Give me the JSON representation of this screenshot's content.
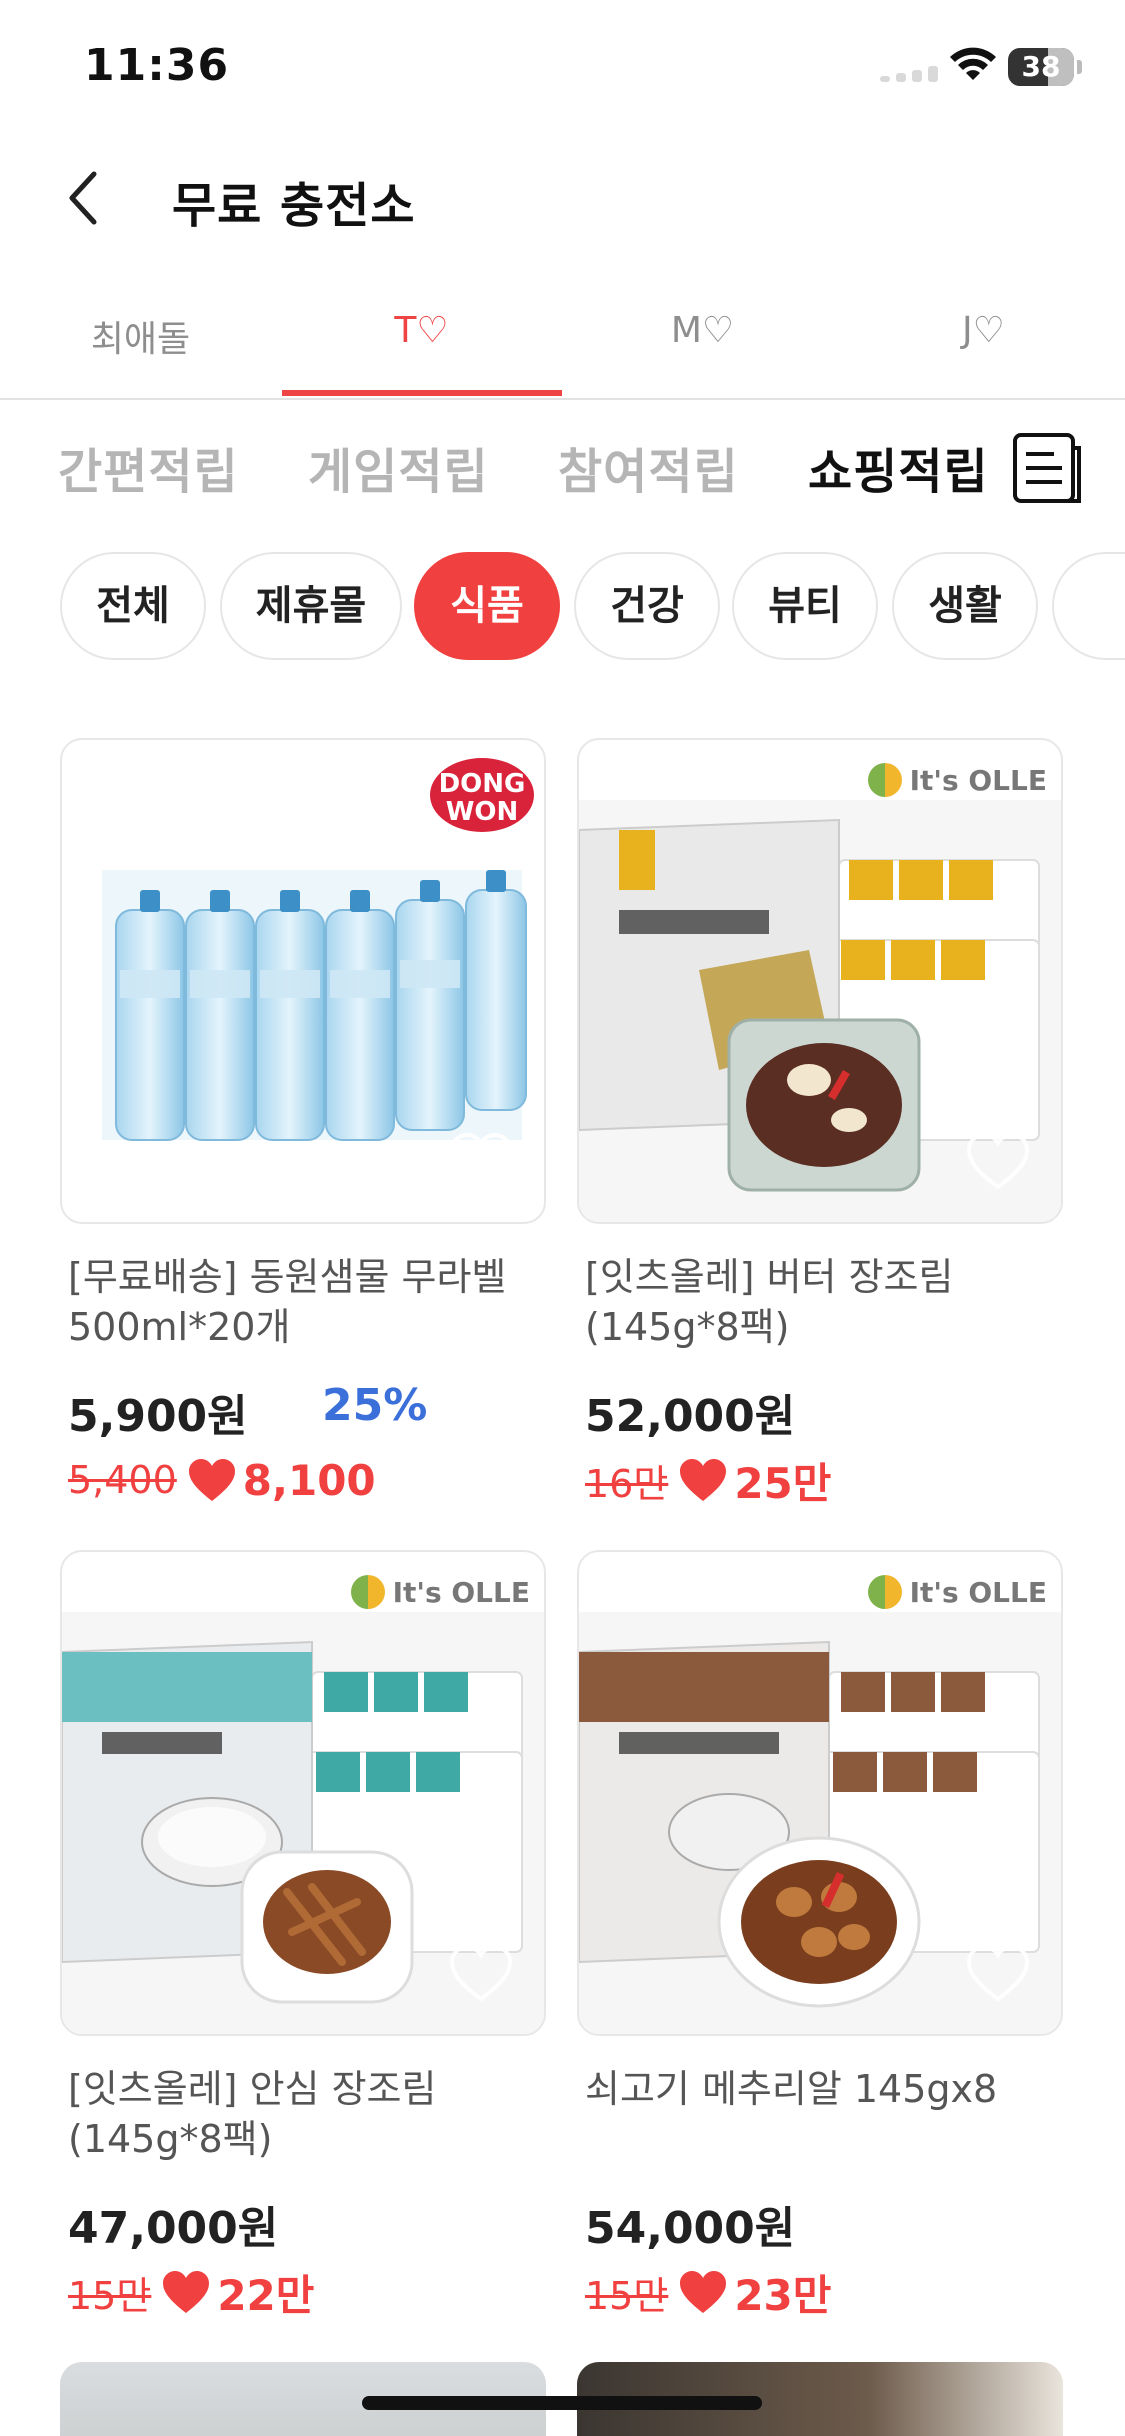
{
  "status": {
    "time": "11:36",
    "battery": "38"
  },
  "header": {
    "title": "무료 충전소"
  },
  "user_tabs": [
    "최애돌",
    "T♡",
    "M♡",
    "J♡"
  ],
  "active_user_tab": 1,
  "category_tabs": [
    "간편적립",
    "게임적립",
    "참여적립",
    "쇼핑적립"
  ],
  "active_category_tab": 3,
  "chips": [
    "전체",
    "제휴몰",
    "식품",
    "건강",
    "뷰티",
    "생활"
  ],
  "active_chip": 2,
  "products": [
    {
      "brand_logo": "DONG WON",
      "name": "[무료배송] 동원샘물 무라벨 500ml*20개",
      "price": "5,900원",
      "discount": "25%",
      "original": "5,400",
      "reward": "8,100"
    },
    {
      "brand_logo": "It's OLLE",
      "name": "[잇츠올레] 버터 장조림 (145g*8팩)",
      "price": "52,000원",
      "discount": "",
      "original": "16만",
      "reward": "25만"
    },
    {
      "brand_logo": "It's OLLE",
      "name": "[잇츠올레] 안심 장조림 (145g*8팩)",
      "price": "47,000원",
      "discount": "",
      "original": "15만",
      "reward": "22만"
    },
    {
      "brand_logo": "It's OLLE",
      "name": "쇠고기 메추리알 145gx8",
      "price": "54,000원",
      "discount": "",
      "original": "15만",
      "reward": "23만"
    }
  ],
  "colors": {
    "accent": "#f0403f",
    "discount": "#3b6fd9",
    "inactive": "#b5b5b5"
  },
  "icons": [
    "back-chevron-icon",
    "list-view-icon",
    "heart-icon",
    "wifi-icon",
    "battery-icon"
  ]
}
